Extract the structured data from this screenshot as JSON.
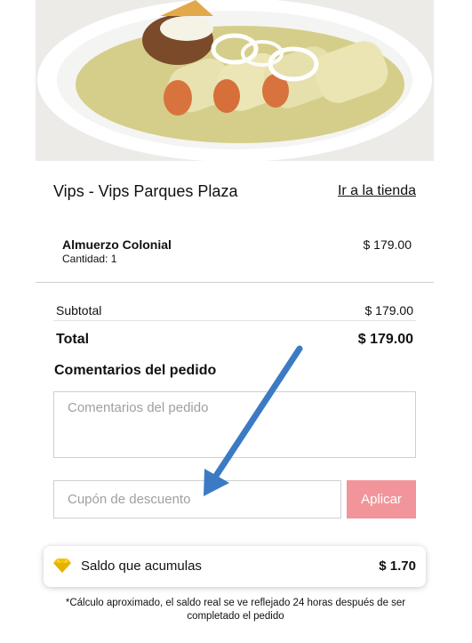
{
  "store": {
    "name": "Vips - Vips Parques Plaza",
    "link_label": "Ir a la tienda"
  },
  "order_item": {
    "name": "Almuerzo Colonial",
    "quantity_label": "Cantidad: 1",
    "price": "$ 179.00"
  },
  "summary": {
    "subtotal_label": "Subtotal",
    "subtotal_value": "$ 179.00",
    "total_label": "Total",
    "total_value": "$ 179.00"
  },
  "comments": {
    "title": "Comentarios del pedido",
    "placeholder": "Comentarios del pedido"
  },
  "coupon": {
    "placeholder": "Cupón de descuento",
    "apply_label": "Aplicar"
  },
  "balance": {
    "icon": "diamond-icon",
    "label": "Saldo que acumulas",
    "value": "$ 1.70"
  },
  "note": "*Cálculo aproximado, el saldo real se ve reflejado 24 horas después de ser completado el pedido",
  "colors": {
    "apply_button": "#f1959a",
    "annotation_arrow": "#3c7bc4",
    "diamond_icon": "#f2c200"
  }
}
